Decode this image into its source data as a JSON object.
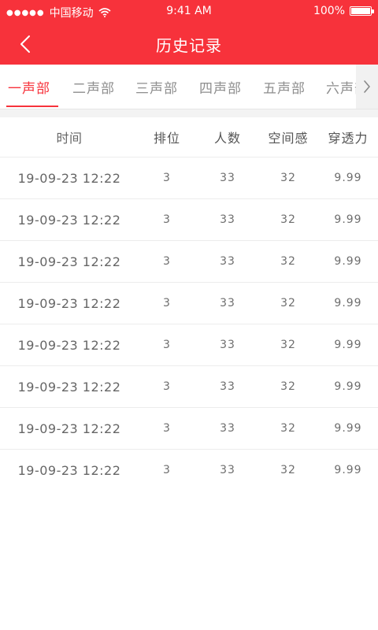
{
  "status_bar": {
    "signal": "●●●●●",
    "carrier": "中国移动",
    "time": "9:41 AM",
    "battery": "100%"
  },
  "nav": {
    "title": "历史记录"
  },
  "tabs": [
    {
      "label": "一声部"
    },
    {
      "label": "二声部"
    },
    {
      "label": "三声部"
    },
    {
      "label": "四声部"
    },
    {
      "label": "五声部"
    },
    {
      "label": "六声部"
    }
  ],
  "active_tab": 0,
  "table": {
    "headers": [
      "时间",
      "排位",
      "人数",
      "空间感",
      "穿透力"
    ],
    "rows": [
      [
        "19-09-23 12:22",
        "3",
        "33",
        "32",
        "9.99"
      ],
      [
        "19-09-23 12:22",
        "3",
        "33",
        "32",
        "9.99"
      ],
      [
        "19-09-23 12:22",
        "3",
        "33",
        "32",
        "9.99"
      ],
      [
        "19-09-23 12:22",
        "3",
        "33",
        "32",
        "9.99"
      ],
      [
        "19-09-23 12:22",
        "3",
        "33",
        "32",
        "9.99"
      ],
      [
        "19-09-23 12:22",
        "3",
        "33",
        "32",
        "9.99"
      ],
      [
        "19-09-23 12:22",
        "3",
        "33",
        "32",
        "9.99"
      ],
      [
        "19-09-23 12:22",
        "3",
        "33",
        "32",
        "9.99"
      ]
    ]
  },
  "colors": {
    "accent": "#f7323b",
    "text_muted": "#8e8e8e"
  }
}
